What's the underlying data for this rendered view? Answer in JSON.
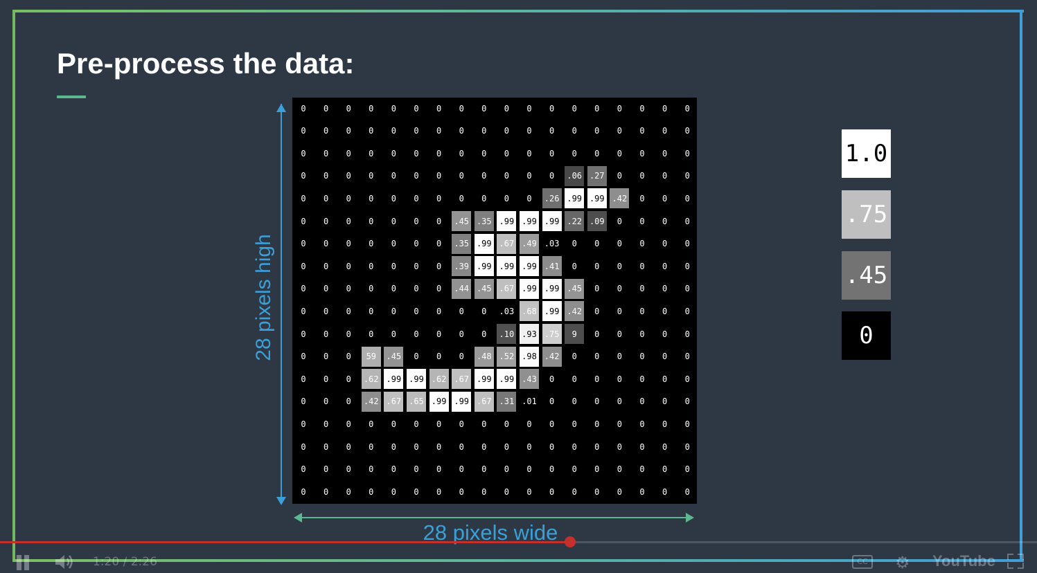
{
  "slide": {
    "title": "Pre-process the data:",
    "height_label": "28 pixels high",
    "width_label": "28 pixels wide"
  },
  "grid": {
    "rows": [
      [
        "0",
        "0",
        "0",
        "0",
        "0",
        "0",
        "0",
        "0",
        "0",
        "0",
        "0",
        "0",
        "0",
        "0",
        "0",
        "0",
        "0",
        "0"
      ],
      [
        "0",
        "0",
        "0",
        "0",
        "0",
        "0",
        "0",
        "0",
        "0",
        "0",
        "0",
        "0",
        "0",
        "0",
        "0",
        "0",
        "0",
        "0"
      ],
      [
        "0",
        "0",
        "0",
        "0",
        "0",
        "0",
        "0",
        "0",
        "0",
        "0",
        "0",
        "0",
        "0",
        "0",
        "0",
        "0",
        "0",
        "0"
      ],
      [
        "0",
        "0",
        "0",
        "0",
        "0",
        "0",
        "0",
        "0",
        "0",
        "0",
        "0",
        "0",
        ".06",
        ".27",
        "0",
        "0",
        "0",
        "0"
      ],
      [
        "0",
        "0",
        "0",
        "0",
        "0",
        "0",
        "0",
        "0",
        "0",
        "0",
        "0",
        ".26",
        ".99",
        ".99",
        ".42",
        "0",
        "0",
        "0"
      ],
      [
        "0",
        "0",
        "0",
        "0",
        "0",
        "0",
        "0",
        ".45",
        ".35",
        ".99",
        ".99",
        ".99",
        ".22",
        ".09",
        "0",
        "0",
        "0",
        "0"
      ],
      [
        "0",
        "0",
        "0",
        "0",
        "0",
        "0",
        "0",
        ".35",
        ".99",
        ".67",
        ".49",
        ".03",
        "0",
        "0",
        "0",
        "0",
        "0",
        "0"
      ],
      [
        "0",
        "0",
        "0",
        "0",
        "0",
        "0",
        "0",
        ".39",
        ".99",
        ".99",
        ".99",
        ".41",
        "0",
        "0",
        "0",
        "0",
        "0",
        "0"
      ],
      [
        "0",
        "0",
        "0",
        "0",
        "0",
        "0",
        "0",
        ".44",
        ".45",
        ".67",
        ".99",
        ".99",
        ".45",
        "0",
        "0",
        "0",
        "0",
        "0"
      ],
      [
        "0",
        "0",
        "0",
        "0",
        "0",
        "0",
        "0",
        "0",
        "0",
        ".03",
        ".68",
        ".99",
        ".42",
        "0",
        "0",
        "0",
        "0",
        "0"
      ],
      [
        "0",
        "0",
        "0",
        "0",
        "0",
        "0",
        "0",
        "0",
        "0",
        ".10",
        ".93",
        ".75",
        "9",
        "0",
        "0",
        "0",
        "0",
        "0"
      ],
      [
        "0",
        "0",
        "0",
        "59",
        ".45",
        "0",
        "0",
        "0",
        ".48",
        ".52",
        ".98",
        ".42",
        "0",
        "0",
        "0",
        "0",
        "0",
        "0"
      ],
      [
        "0",
        "0",
        "0",
        ".62",
        ".99",
        ".99",
        ".62",
        ".67",
        ".99",
        ".99",
        ".43",
        "0",
        "0",
        "0",
        "0",
        "0",
        "0",
        "0"
      ],
      [
        "0",
        "0",
        "0",
        ".42",
        ".67",
        ".65",
        ".99",
        ".99",
        ".67",
        ".31",
        ".01",
        "0",
        "0",
        "0",
        "0",
        "0",
        "0",
        "0"
      ],
      [
        "0",
        "0",
        "0",
        "0",
        "0",
        "0",
        "0",
        "0",
        "0",
        "0",
        "0",
        "0",
        "0",
        "0",
        "0",
        "0",
        "0",
        "0"
      ],
      [
        "0",
        "0",
        "0",
        "0",
        "0",
        "0",
        "0",
        "0",
        "0",
        "0",
        "0",
        "0",
        "0",
        "0",
        "0",
        "0",
        "0",
        "0"
      ],
      [
        "0",
        "0",
        "0",
        "0",
        "0",
        "0",
        "0",
        "0",
        "0",
        "0",
        "0",
        "0",
        "0",
        "0",
        "0",
        "0",
        "0",
        "0"
      ],
      [
        "0",
        "0",
        "0",
        "0",
        "0",
        "0",
        "0",
        "0",
        "0",
        "0",
        "0",
        "0",
        "0",
        "0",
        "0",
        "0",
        "0",
        "0"
      ]
    ]
  },
  "legend": [
    {
      "label": "1.0",
      "bg": "#ffffff",
      "fg": "#000000"
    },
    {
      "label": ".75",
      "bg": "#bfbfbf",
      "fg": "#ffffff"
    },
    {
      "label": ".45",
      "bg": "#737373",
      "fg": "#ffffff"
    },
    {
      "label": "0",
      "bg": "#000000",
      "fg": "#ffffff"
    }
  ],
  "player": {
    "time": "1:20 / 2:26",
    "progress": 0.55,
    "logo": "YouTube",
    "cc_label": "CC"
  },
  "colors": {
    "frame_green": "#7cbf62",
    "frame_blue": "#3f9fd6",
    "label_blue": "#3b9fd8",
    "arrow_green": "#5cb88f"
  }
}
